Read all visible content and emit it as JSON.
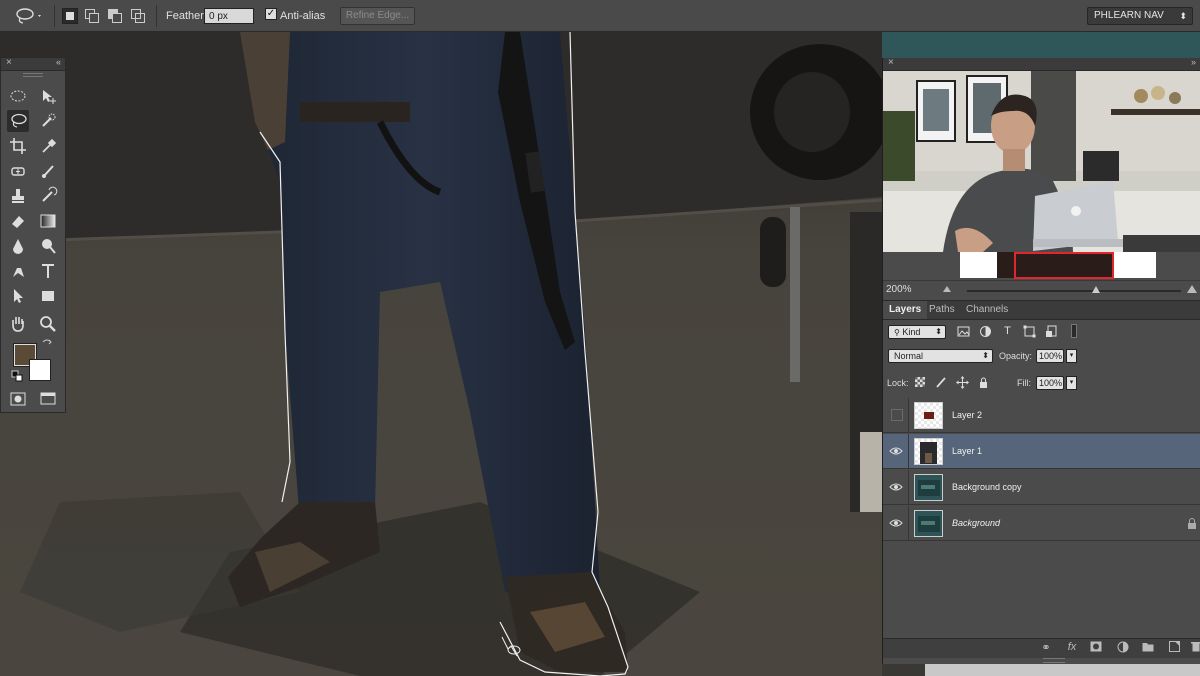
{
  "options_bar": {
    "feather_label": "Feather:",
    "feather_value": "0 px",
    "anti_alias_label": "Anti-alias",
    "anti_alias_checked": "✓",
    "refine_edge_label": "Refine Edge...",
    "workspace_label": "PHLEARN NAV",
    "workspace_arrow": "⬍"
  },
  "tools_panel": {
    "close": "×",
    "collapse": "«"
  },
  "navigator": {
    "close": "×",
    "collapse": "»",
    "zoom_value": "200%"
  },
  "layers_panel": {
    "tabs": [
      "Layers",
      "Paths",
      "Channels"
    ],
    "filter_kind": "Kind",
    "blend_mode": "Normal",
    "opacity_label": "Opacity:",
    "opacity_value": "100%",
    "lock_label": "Lock:",
    "fill_label": "Fill:",
    "fill_value": "100%",
    "layers": [
      {
        "name": "Layer 2",
        "visible": false,
        "selected": false
      },
      {
        "name": "Layer 1",
        "visible": true,
        "selected": true
      },
      {
        "name": "Background copy",
        "visible": true,
        "selected": false
      },
      {
        "name": "Background",
        "visible": true,
        "selected": false,
        "locked": true
      }
    ]
  },
  "colors": {
    "foreground": "#5a4a36",
    "background": "#ffffff",
    "selected_layer": "#566579",
    "panel": "#4b4b4b"
  }
}
